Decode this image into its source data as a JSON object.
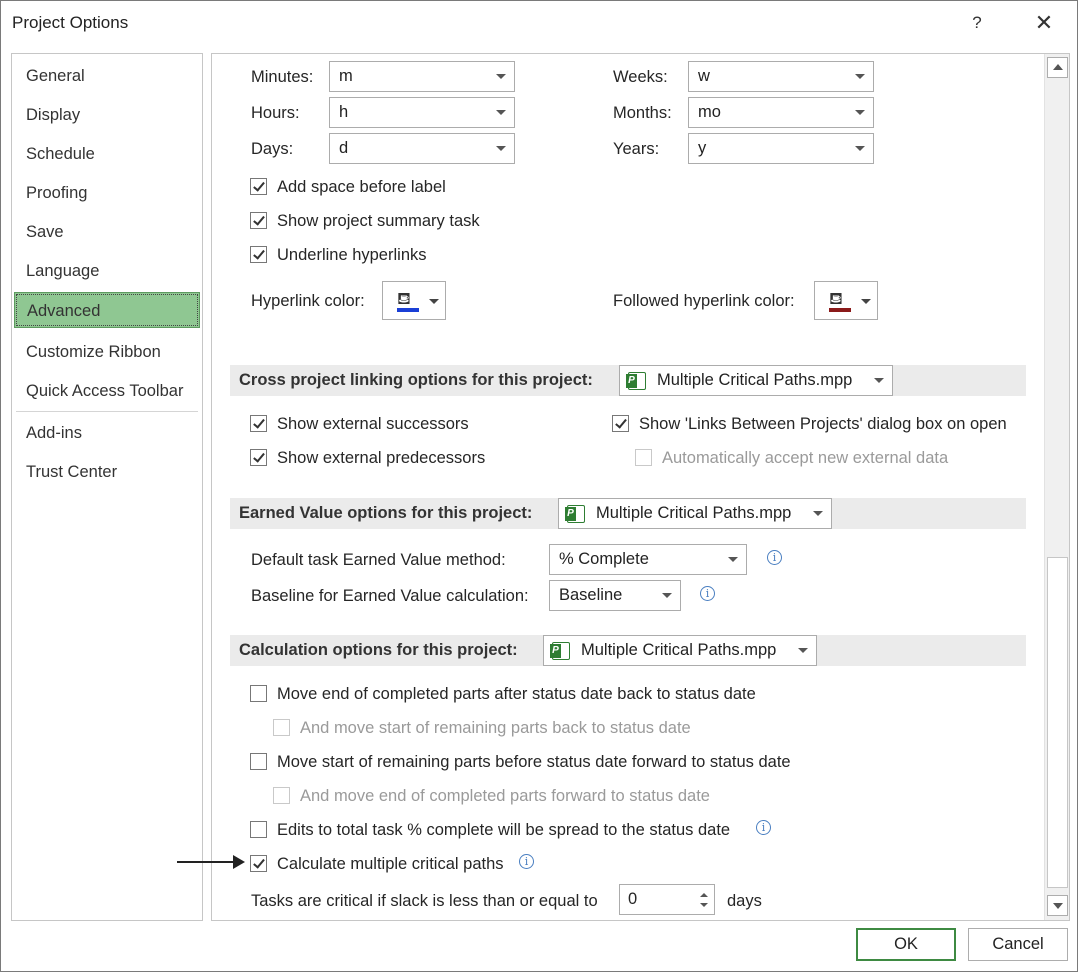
{
  "window": {
    "title": "Project Options",
    "help_label": "?",
    "close_label": "✕"
  },
  "nav": {
    "items": [
      {
        "label": "General"
      },
      {
        "label": "Display"
      },
      {
        "label": "Schedule"
      },
      {
        "label": "Proofing"
      },
      {
        "label": "Save"
      },
      {
        "label": "Language"
      },
      {
        "label": "Advanced",
        "active": true
      },
      {
        "label": "Customize Ribbon"
      },
      {
        "label": "Quick Access Toolbar"
      },
      {
        "label": "Add-ins"
      },
      {
        "label": "Trust Center"
      }
    ]
  },
  "units": {
    "minutes_label": "Minutes:",
    "minutes_value": "m",
    "hours_label": "Hours:",
    "hours_value": "h",
    "days_label": "Days:",
    "days_value": "d",
    "weeks_label": "Weeks:",
    "weeks_value": "w",
    "months_label": "Months:",
    "months_value": "mo",
    "years_label": "Years:",
    "years_value": "y"
  },
  "display_opts": {
    "add_space": "Add space before label",
    "show_summary": "Show project summary task",
    "underline_links": "Underline hyperlinks",
    "hyperlink_color_label": "Hyperlink color:",
    "followed_color_label": "Followed hyperlink color:",
    "hyperlink_color": "#1a3fd6",
    "followed_color": "#8b1a1a"
  },
  "cross_project": {
    "title": "Cross project linking options for this project:",
    "project": "Multiple Critical Paths.mpp",
    "show_successors": "Show external successors",
    "show_predecessors": "Show external predecessors",
    "show_links_dialog": "Show 'Links Between Projects' dialog box on open",
    "auto_accept": "Automatically accept new external data"
  },
  "earned_value": {
    "title": "Earned Value options for this project:",
    "project": "Multiple Critical Paths.mpp",
    "method_label": "Default task Earned Value method:",
    "method_value": "% Complete",
    "baseline_label": "Baseline for Earned Value calculation:",
    "baseline_value": "Baseline"
  },
  "calculation": {
    "title": "Calculation options for this project:",
    "project": "Multiple Critical Paths.mpp",
    "move_end": "Move end of completed parts after status date back to status date",
    "move_start_back": "And move start of remaining parts back to status date",
    "move_start_forward": "Move start of remaining parts before status date forward to status date",
    "move_end_forward": "And move end of completed parts forward to status date",
    "edits_spread": "Edits to total task % complete will be spread to the status date",
    "multiple_paths": "Calculate multiple critical paths",
    "slack_label": "Tasks are critical if slack is less than or equal to",
    "slack_value": "0",
    "slack_unit": "days"
  },
  "buttons": {
    "ok": "OK",
    "cancel": "Cancel"
  },
  "icons": {
    "info": "i",
    "bucket": "⛾"
  }
}
